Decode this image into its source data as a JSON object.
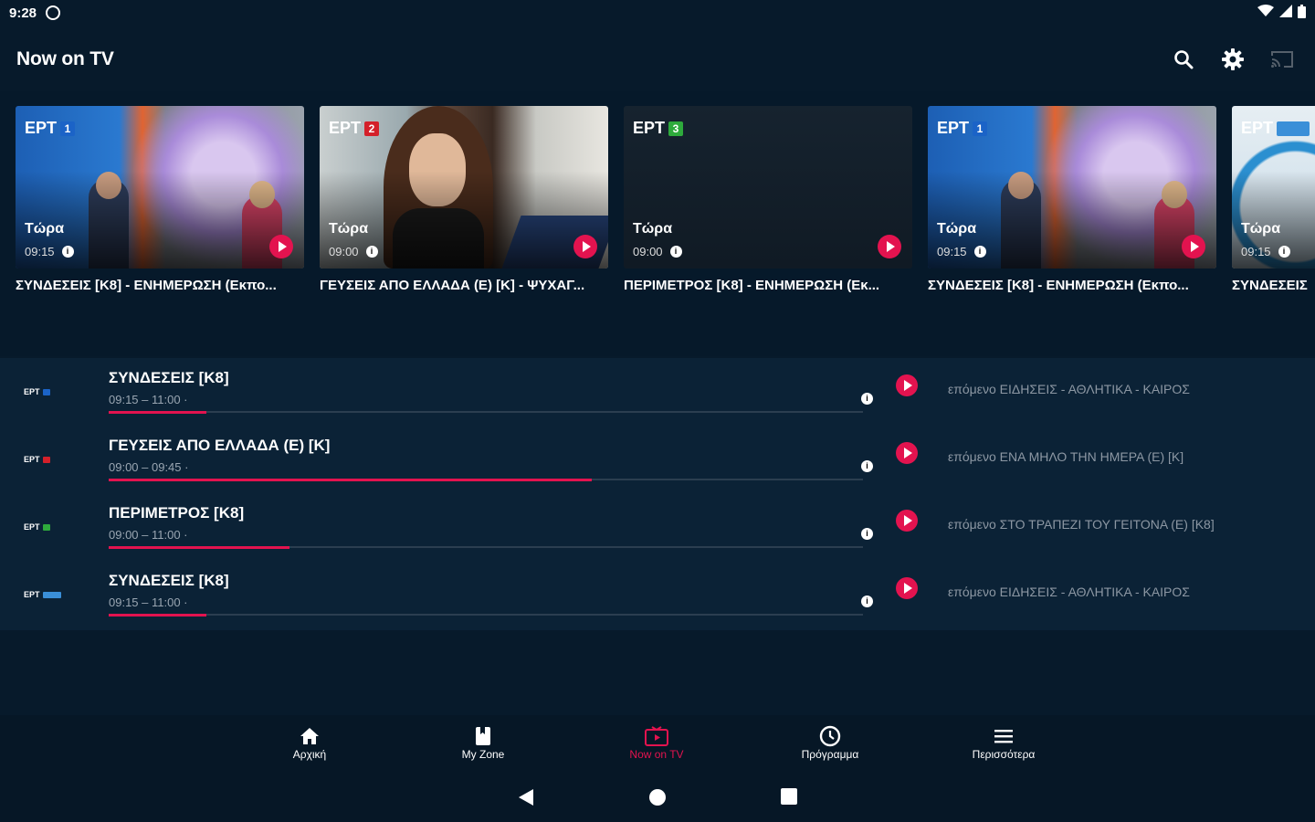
{
  "status": {
    "time": "9:28"
  },
  "appbar": {
    "title": "Now on TV"
  },
  "cards": [
    {
      "channel": "ΕΡΤ",
      "channel_num": "1",
      "now": "Τώρα",
      "time": "09:15",
      "caption": "ΣΥΝΔΕΣΕΙΣ [Κ8] - ΕΝΗΜΕΡΩΣΗ (Εκπο..."
    },
    {
      "channel": "ΕΡΤ",
      "channel_num": "2",
      "now": "Τώρα",
      "time": "09:00",
      "caption": "ΓΕΥΣΕΙΣ ΑΠΟ ΕΛΛΑΔΑ (Ε) [Κ] - ΨΥΧΑΓ..."
    },
    {
      "channel": "ΕΡΤ",
      "channel_num": "3",
      "now": "Τώρα",
      "time": "09:00",
      "caption": "ΠΕΡΙΜΕΤΡΟΣ [Κ8] - ΕΝΗΜΕΡΩΣΗ (Εκ..."
    },
    {
      "channel": "ΕΡΤ",
      "channel_num": "1",
      "now": "Τώρα",
      "time": "09:15",
      "caption": "ΣΥΝΔΕΣΕΙΣ [Κ8] - ΕΝΗΜΕΡΩΣΗ (Εκπο..."
    },
    {
      "channel": "ΕΡΤ",
      "channel_num": "",
      "now": "Τώρα",
      "time": "09:15",
      "caption": "ΣΥΝΔΕΣΕΙΣ"
    }
  ],
  "rows": [
    {
      "logo": "ΕΡΤ",
      "title": "ΣΥΝΔΕΣΕΙΣ [Κ8]",
      "time": "09:15 – 11:00 ·",
      "progress": 0.13,
      "next": "επόμενο ΕΙΔΗΣΕΙΣ - ΑΘΛΗΤΙΚΑ - ΚΑΙΡΟΣ"
    },
    {
      "logo": "ΕΡΤ",
      "title": "ΓΕΥΣΕΙΣ ΑΠΟ ΕΛΛΑΔΑ (Ε) [Κ]",
      "time": "09:00 – 09:45 ·",
      "progress": 0.64,
      "next": "επόμενο ΕΝΑ ΜΗΛΟ ΤΗΝ ΗΜΕΡΑ (Ε) [Κ]"
    },
    {
      "logo": "ΕΡΤ",
      "title": "ΠΕΡΙΜΕΤΡΟΣ [Κ8]",
      "time": "09:00 – 11:00 ·",
      "progress": 0.24,
      "next": "επόμενο ΣΤΟ ΤΡΑΠΕΖΙ ΤΟΥ ΓΕΙΤΟΝΑ (Ε) [Κ8]"
    },
    {
      "logo": "ΕΡΤ",
      "title": "ΣΥΝΔΕΣΕΙΣ [Κ8]",
      "time": "09:15 – 11:00 ·",
      "progress": 0.13,
      "next": "επόμενο ΕΙΔΗΣΕΙΣ - ΑΘΛΗΤΙΚΑ - ΚΑΙΡΟΣ"
    }
  ],
  "nav": [
    {
      "label": "Αρχική",
      "icon": "home-icon"
    },
    {
      "label": "My Zone",
      "icon": "bookmark-icon"
    },
    {
      "label": "Now on TV",
      "icon": "tv-play-icon"
    },
    {
      "label": "Πρόγραμμα",
      "icon": "clock-icon"
    },
    {
      "label": "Περισσότερα",
      "icon": "menu-icon"
    }
  ],
  "colors": {
    "accent": "#e3134f",
    "background": "#071a2b",
    "list_bg": "#0b2236"
  }
}
